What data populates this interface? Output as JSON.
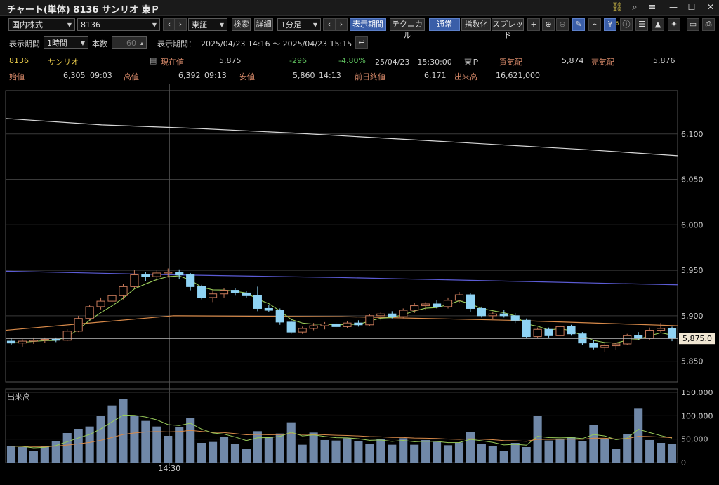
{
  "window": {
    "title": "チャート(単体) 8136 サンリオ 東Ｐ",
    "link_badge": "6"
  },
  "toolbar": {
    "market": "国内株式",
    "code": "8136",
    "exchange": "東証",
    "search_label": "検索",
    "detail_label": "詳細",
    "interval": "1分足",
    "period_label": "表示期間",
    "technical_label": "テクニカル",
    "normal_label": "通常",
    "index_label": "指数化",
    "spread_label": "スプレッド"
  },
  "range_bar": {
    "period_label": "表示期間",
    "period_value": "1時間",
    "count_label": "本数",
    "count_value": "60",
    "range_label": "表示期間：",
    "range_value": "2025/04/23 14:16 ～ 2025/04/23 15:15"
  },
  "quote": {
    "code": "8136",
    "name": "サンリオ",
    "current_label": "現在値",
    "current_value": "5,875",
    "change": "-296",
    "change_pct": "-4.80%",
    "datetime": "25/04/23　15:30:00",
    "market": "東Ｐ",
    "bid_label": "買気配",
    "bid_value": "5,874",
    "ask_label": "売気配",
    "ask_value": "5,876",
    "open_label": "始値",
    "open_value": "6,305",
    "open_time": "09:03",
    "high_label": "高値",
    "high_value": "6,392",
    "high_time": "09:13",
    "low_label": "安値",
    "low_value": "5,860",
    "low_time": "14:13",
    "prev_close_label": "前日終値",
    "prev_close_value": "6,171",
    "volume_label": "出来高",
    "volume_value": "16,621,000"
  },
  "colors": {
    "up": "#c87a5a",
    "down": "#8fd3f4",
    "accent": "#3a5ea8",
    "change_neg": "#5ec05e",
    "code": "#e6c84a"
  },
  "chart_data": [
    {
      "type": "candlestick",
      "x_tick_label": "14:30",
      "y_ticks": [
        "6,100",
        "6,050",
        "6,000",
        "5,950",
        "5,900",
        "5,850"
      ],
      "ylim": [
        5835,
        6140
      ],
      "last_price_label": "5,875.0",
      "candles": [
        [
          5872,
          5875,
          5868,
          5870
        ],
        [
          5870,
          5874,
          5866,
          5872
        ],
        [
          5872,
          5876,
          5869,
          5873
        ],
        [
          5873,
          5876,
          5870,
          5874
        ],
        [
          5874,
          5876,
          5871,
          5873
        ],
        [
          5873,
          5885,
          5872,
          5883
        ],
        [
          5883,
          5900,
          5882,
          5897
        ],
        [
          5897,
          5912,
          5895,
          5910
        ],
        [
          5910,
          5920,
          5907,
          5916
        ],
        [
          5916,
          5925,
          5913,
          5922
        ],
        [
          5922,
          5935,
          5918,
          5932
        ],
        [
          5932,
          5950,
          5930,
          5945
        ],
        [
          5945,
          5948,
          5938,
          5943
        ],
        [
          5943,
          5950,
          5938,
          5947
        ],
        [
          5947,
          5952,
          5942,
          5948
        ],
        [
          5948,
          5951,
          5940,
          5945
        ],
        [
          5945,
          5947,
          5928,
          5932
        ],
        [
          5932,
          5934,
          5918,
          5920
        ],
        [
          5920,
          5928,
          5915,
          5924
        ],
        [
          5924,
          5930,
          5920,
          5928
        ],
        [
          5928,
          5930,
          5922,
          5925
        ],
        [
          5925,
          5927,
          5920,
          5922
        ],
        [
          5922,
          5932,
          5905,
          5908
        ],
        [
          5908,
          5912,
          5904,
          5906
        ],
        [
          5906,
          5908,
          5890,
          5893
        ],
        [
          5893,
          5896,
          5880,
          5882
        ],
        [
          5882,
          5888,
          5880,
          5886
        ],
        [
          5886,
          5892,
          5884,
          5889
        ],
        [
          5889,
          5893,
          5885,
          5891
        ],
        [
          5891,
          5893,
          5886,
          5888
        ],
        [
          5888,
          5894,
          5886,
          5892
        ],
        [
          5892,
          5895,
          5888,
          5890
        ],
        [
          5890,
          5902,
          5889,
          5900
        ],
        [
          5900,
          5904,
          5895,
          5902
        ],
        [
          5902,
          5905,
          5897,
          5899
        ],
        [
          5899,
          5908,
          5897,
          5906
        ],
        [
          5906,
          5914,
          5903,
          5911
        ],
        [
          5911,
          5915,
          5906,
          5913
        ],
        [
          5913,
          5917,
          5908,
          5910
        ],
        [
          5910,
          5920,
          5908,
          5917
        ],
        [
          5917,
          5926,
          5914,
          5923
        ],
        [
          5923,
          5925,
          5904,
          5908
        ],
        [
          5908,
          5910,
          5898,
          5900
        ],
        [
          5900,
          5904,
          5896,
          5902
        ],
        [
          5902,
          5906,
          5898,
          5900
        ],
        [
          5900,
          5903,
          5892,
          5895
        ],
        [
          5895,
          5897,
          5875,
          5877
        ],
        [
          5877,
          5887,
          5875,
          5885
        ],
        [
          5885,
          5887,
          5876,
          5878
        ],
        [
          5878,
          5890,
          5876,
          5888
        ],
        [
          5888,
          5890,
          5878,
          5880
        ],
        [
          5880,
          5882,
          5868,
          5870
        ],
        [
          5870,
          5873,
          5863,
          5865
        ],
        [
          5865,
          5870,
          5860,
          5867
        ],
        [
          5867,
          5870,
          5862,
          5869
        ],
        [
          5869,
          5880,
          5868,
          5878
        ],
        [
          5878,
          5882,
          5873,
          5875
        ],
        [
          5875,
          5887,
          5873,
          5884
        ],
        [
          5884,
          5892,
          5882,
          5886
        ],
        [
          5886,
          5888,
          5872,
          5875
        ]
      ],
      "ma_long": [
        5949,
        5945,
        5942,
        5938,
        5934
      ],
      "ma_mid": [
        5884,
        5900,
        5899,
        5895,
        5889
      ],
      "ma_short": [
        5873,
        5920,
        5900,
        5911,
        5880
      ],
      "upper_line": [
        6117,
        6110,
        6106,
        6101,
        6095,
        6089,
        6083,
        6076
      ],
      "volume_label": "出来高",
      "volume_ticks": [
        "150,000",
        "100,000",
        "50,000",
        "0"
      ],
      "volume_max": 150000,
      "volumes": [
        35000,
        33000,
        25000,
        35000,
        45000,
        63000,
        72000,
        77000,
        100000,
        122000,
        135000,
        100000,
        89000,
        77000,
        57000,
        75000,
        95000,
        42000,
        44000,
        55000,
        40000,
        29000,
        67000,
        54000,
        62000,
        86000,
        38000,
        64000,
        48000,
        47000,
        52000,
        46000,
        40000,
        50000,
        38000,
        52000,
        38000,
        48000,
        44000,
        37000,
        43000,
        65000,
        40000,
        35000,
        25000,
        42000,
        33000,
        100000,
        47000,
        51000,
        55000,
        46000,
        80000,
        50000,
        30000,
        60000,
        115000,
        48000,
        42000,
        40000
      ]
    }
  ]
}
